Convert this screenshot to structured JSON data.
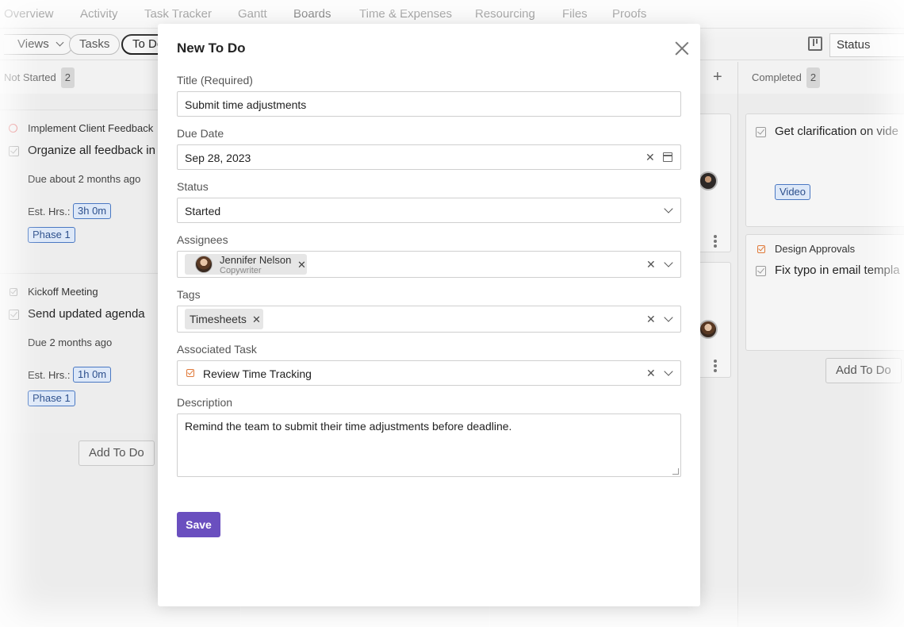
{
  "nav": {
    "tabs": [
      "Overview",
      "Activity",
      "Task Tracker",
      "Gantt",
      "Boards",
      "Time & Expenses",
      "Resourcing",
      "Files",
      "Proofs"
    ],
    "active": "Boards"
  },
  "toolbar": {
    "views_label": "Views",
    "tasks_label": "Tasks",
    "todo_label": "To Do",
    "status_select": "Status"
  },
  "board": {
    "columns": [
      {
        "name": "Not Started",
        "count": "2",
        "cards": [
          {
            "task": "Implement Client Feedback",
            "title": "Organize all feedback in s",
            "due": "Due about 2 months ago",
            "est_label": "Est. Hrs.:",
            "est": "3h 0m",
            "tag": "Phase 1"
          },
          {
            "task": "Kickoff Meeting",
            "title": "Send updated agenda",
            "due": "Due 2 months ago",
            "est_label": "Est. Hrs.:",
            "est": "1h 0m",
            "tag": "Phase 1"
          }
        ],
        "add_label": "Add To Do"
      },
      {
        "name": "Completed",
        "count": "2",
        "cards": [
          {
            "title": "Get clarification on vide",
            "tag": "Video"
          },
          {
            "task": "Design Approvals",
            "title": "Fix typo in email templa"
          }
        ],
        "add_label": "Add To Do"
      }
    ]
  },
  "modal": {
    "title": "New To Do",
    "title_label": "Title (Required)",
    "title_value": "Submit time adjustments",
    "due_label": "Due Date",
    "due_value": "Sep 28, 2023",
    "status_label": "Status",
    "status_value": "Started",
    "assignees_label": "Assignees",
    "assignee_name": "Jennifer Nelson",
    "assignee_role": "Copywriter",
    "tags_label": "Tags",
    "tag_value": "Timesheets",
    "assoc_label": "Associated Task",
    "assoc_value": "Review Time Tracking",
    "desc_label": "Description",
    "desc_value": "Remind the team to submit their time adjustments before deadline.",
    "save_label": "Save",
    "clear_glyph": "✕",
    "remove_glyph": "✕"
  },
  "colors": {
    "accent": "#6a4fbf",
    "tag_border": "#4a78c2",
    "tag_bg": "#dde8f8"
  }
}
